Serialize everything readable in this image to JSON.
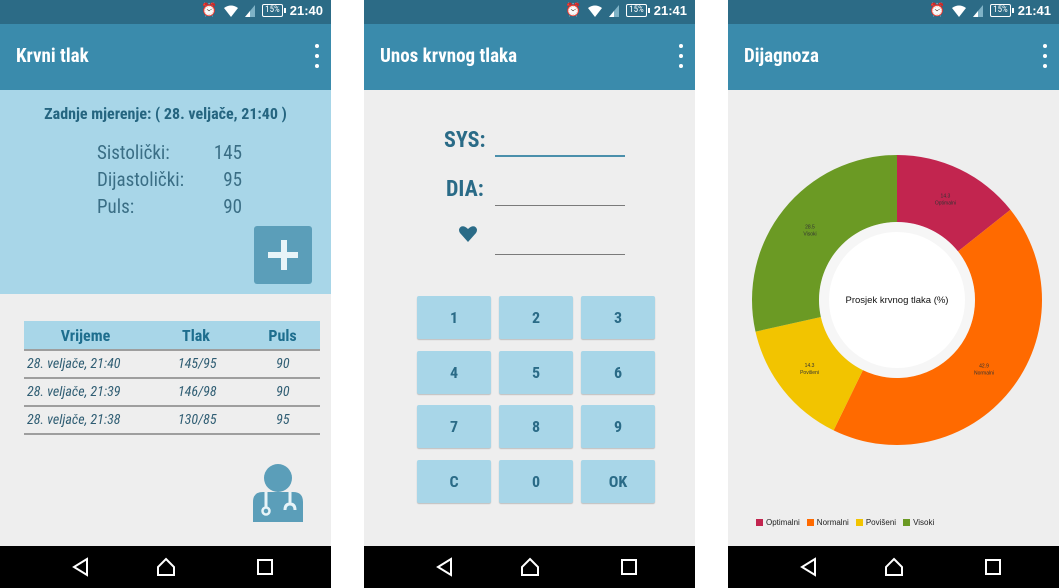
{
  "status_bar": {
    "battery": "15%",
    "time_1": "21:40",
    "time_2": "21:41",
    "time_3": "21:41",
    "icons": [
      "alarm-icon",
      "wifi-icon",
      "signal-icon",
      "battery-icon"
    ]
  },
  "colors": {
    "statusbar": "#2c6b86",
    "appbar": "#3a8bac",
    "panel": "#a8d6e8",
    "accent_text": "#2a6b87",
    "optimalni": "#c2254f",
    "normalni": "#ff6a00",
    "povise": "#f2c400",
    "visoki": "#6b9a24"
  },
  "screen1": {
    "title": "Krvni tlak",
    "last_measurement": "Zadnje mjerenje: ( 28. veljače, 21:40 )",
    "systolic_label": "Sistolički:",
    "systolic_value": "145",
    "diastolic_label": "Dijastolički:",
    "diastolic_value": "95",
    "pulse_label": "Puls:",
    "pulse_value": "90",
    "table": {
      "headers": [
        "Vrijeme",
        "Tlak",
        "Puls"
      ],
      "rows": [
        [
          "28. veljače, 21:40",
          "145/95",
          "90"
        ],
        [
          "28. veljače, 21:39",
          "146/98",
          "90"
        ],
        [
          "28. veljače, 21:38",
          "130/85",
          "95"
        ]
      ]
    }
  },
  "screen2": {
    "title": "Unos krvnog tlaka",
    "sys_label": "SYS:",
    "dia_label": "DIA:",
    "keys": [
      "1",
      "2",
      "3",
      "4",
      "5",
      "6",
      "7",
      "8",
      "9",
      "C",
      "0",
      "OK"
    ]
  },
  "screen3": {
    "title": "Dijagnoza",
    "center_label": "Prosjek krvnog tlaka (%)",
    "chart_data": {
      "type": "pie",
      "title": "Prosjek krvnog tlaka (%)",
      "labels": [
        "Optimalni",
        "Normalni",
        "Povišeni",
        "Visoki"
      ],
      "values": [
        14.3,
        42.9,
        14.3,
        28.5
      ],
      "value_texts": [
        "14.3",
        "42.9",
        "14.3",
        "28.5"
      ],
      "colors": [
        "#c2254f",
        "#ff6a00",
        "#f2c400",
        "#6b9a24"
      ],
      "legend_position": "bottom-left"
    }
  }
}
